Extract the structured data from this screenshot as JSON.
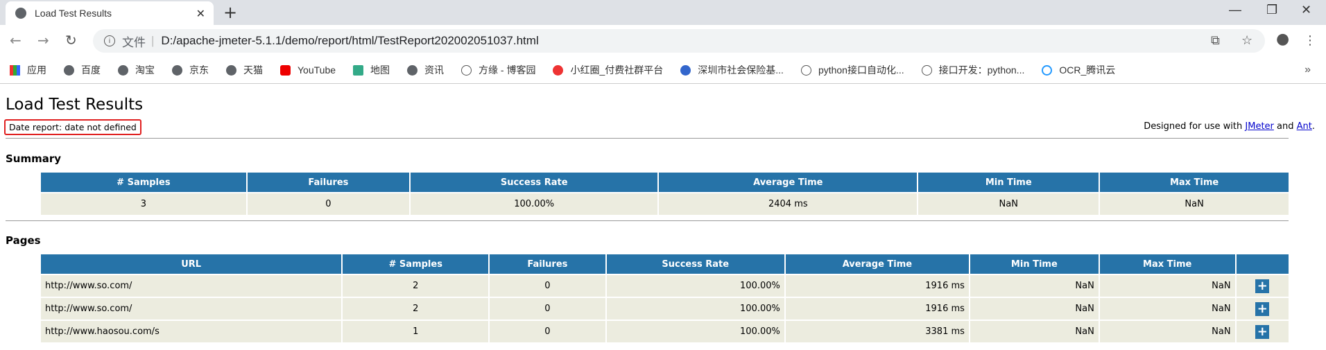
{
  "browser": {
    "tab_title": "Load Test Results",
    "url_prefix": "文件",
    "url": "D:/apache-jmeter-5.1.1/demo/report/html/TestReport202002051037.html",
    "bookmarks": [
      "应用",
      "百度",
      "淘宝",
      "京东",
      "天猫",
      "YouTube",
      "地图",
      "资讯",
      "方缘 - 博客园",
      "小红圈_付费社群平台",
      "深圳市社会保险基...",
      "python接口自动化...",
      "接口开发：python...",
      "OCR_腾讯云"
    ],
    "more": "»"
  },
  "page": {
    "title": "Load Test Results",
    "date": "Date report: date not defined",
    "designed_prefix": "Designed for use with ",
    "jmeter": "JMeter",
    "and": " and ",
    "ant": "Ant",
    "period": "."
  },
  "summary": {
    "heading": "Summary",
    "headers": [
      "# Samples",
      "Failures",
      "Success Rate",
      "Average Time",
      "Min Time",
      "Max Time"
    ],
    "row": [
      "3",
      "0",
      "100.00%",
      "2404 ms",
      "NaN",
      "NaN"
    ]
  },
  "pages": {
    "heading": "Pages",
    "headers": [
      "URL",
      "# Samples",
      "Failures",
      "Success Rate",
      "Average Time",
      "Min Time",
      "Max Time",
      ""
    ],
    "rows": [
      [
        "http://www.so.com/",
        "2",
        "0",
        "100.00%",
        "1916 ms",
        "NaN",
        "NaN"
      ],
      [
        "http://www.so.com/",
        "2",
        "0",
        "100.00%",
        "1916 ms",
        "NaN",
        "NaN"
      ],
      [
        "http://www.haosou.com/s",
        "1",
        "0",
        "100.00%",
        "3381 ms",
        "NaN",
        "NaN"
      ]
    ],
    "expand_label": "+"
  },
  "colors": {
    "header_bg": "#2673a8",
    "cell_bg": "#ececdf",
    "highlight": "#e02020"
  }
}
